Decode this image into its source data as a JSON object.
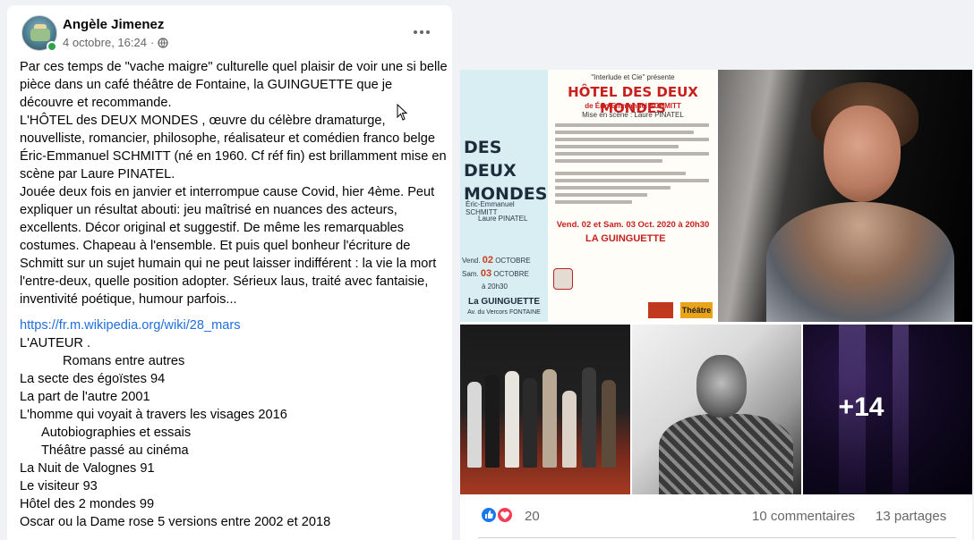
{
  "post": {
    "author": "Angèle Jimenez",
    "date": "4 octobre, 16:24",
    "separator": "·",
    "paragraphs": [
      "Par ces temps de \"vache maigre\" culturelle quel plaisir de voir une si belle pièce dans un café théâtre de Fontaine, la GUINGUETTE que je découvre et recommande.",
      "L'HÔTEL des DEUX MONDES , œuvre du célèbre dramaturge, nouvelliste, romancier, philosophe, réalisateur et comédien franco belge Éric-Emmanuel SCHMITT (né en 1960. Cf réf fin) est brillamment mise en scène par Laure PINATEL.",
      "Jouée deux fois en janvier et interrompue cause Covid, hier 4ème. Peut expliquer un résultat abouti: jeu maîtrisé en nuances des acteurs, excellents. Décor original et suggestif. De même  les remarquables costumes. Chapeau à l'ensemble. Et puis quel bonheur l'écriture de Schmitt sur un sujet humain qui ne peut laisser indifférent :  la vie la mort l'entre-deux, quelle  position adopter. Sérieux laus, traité avec fantaisie, inventivité poétique,  humour parfois..."
    ],
    "link": "https://fr.m.wikipedia.org/wiki/28_mars",
    "list": [
      {
        "text": "L'AUTEUR .",
        "indent": 0
      },
      {
        "text": "Romans entre autres",
        "indent": 1
      },
      {
        "text": "La secte des égoïstes 94",
        "indent": 0
      },
      {
        "text": "La part de l'autre 2001",
        "indent": 0
      },
      {
        "text": "L'homme qui voyait à travers les visages 2016",
        "indent": 0
      },
      {
        "text": "Autobiographies et essais",
        "indent": 2
      },
      {
        "text": "Théâtre passé au cinéma",
        "indent": 2
      },
      {
        "text": "La Nuit de Valognes 91",
        "indent": 0
      },
      {
        "text": "Le visiteur 93",
        "indent": 0
      },
      {
        "text": "Hôtel des 2 mondes 99",
        "indent": 0
      },
      {
        "text": "Oscar ou la Dame rose 5 versions entre 2002 et 2018",
        "indent": 0
      }
    ]
  },
  "poster": {
    "presents": "\"Interlude et Cie\" présente",
    "title": "HÔTEL DES DEUX MONDES",
    "title_left": "DES DEUX MONDES",
    "author": "de Éric-Emmanuel SCHMITT",
    "director": "Mise en scène : Laure PINATEL",
    "left_author": "Éric-Emmanuel SCHMITT",
    "left_director": "Laure PINATEL",
    "dates_right": "Vend. 02 et Sam. 03 Oct. 2020 à 20h30",
    "venue": "LA GUINGUETTE",
    "date_line1_day": "Vend.",
    "date_line1_num": "02",
    "date_line1_month": "OCTOBRE",
    "date_line2_day": "Sam.",
    "date_line2_num": "03",
    "date_line2_month": "OCTOBRE",
    "time": "à 20h30",
    "venue_left": "La GUINGUETTE",
    "address_left": "Av. du Vercors FONTAINE",
    "logo2": "Théâtre AURA"
  },
  "gallery": {
    "more_count": "+14"
  },
  "reactions": {
    "count": "20",
    "comments": "10 commentaires",
    "shares": "13 partages",
    "like_color": "#1877f2",
    "love_color": "#f33e58"
  }
}
